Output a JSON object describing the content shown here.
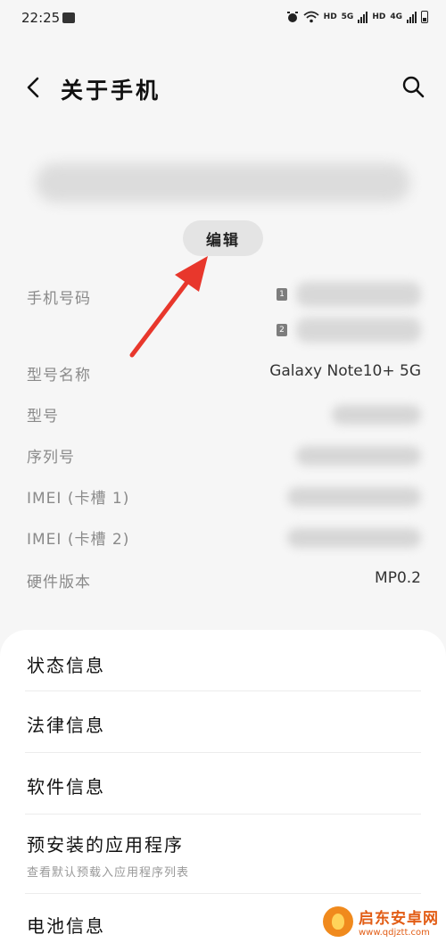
{
  "status_bar": {
    "time": "22:25",
    "indicators": [
      "HD",
      "5G",
      "HD",
      "4G"
    ],
    "icons": [
      "photo-icon",
      "alarm-icon",
      "wifi-icon",
      "signal-icon",
      "battery-icon"
    ]
  },
  "header": {
    "title": "关于手机",
    "back_icon": "back-arrow-icon",
    "search_icon": "search-icon"
  },
  "device": {
    "edit_label": "编辑"
  },
  "info": {
    "phone_number": {
      "label": "手机号码",
      "sim1_badge": "1",
      "sim2_badge": "2"
    },
    "model_name": {
      "label": "型号名称",
      "value": "Galaxy Note10+ 5G"
    },
    "model": {
      "label": "型号"
    },
    "serial": {
      "label": "序列号"
    },
    "imei1": {
      "label": "IMEI (卡槽 1)"
    },
    "imei2": {
      "label": "IMEI (卡槽 2)"
    },
    "hardware": {
      "label": "硬件版本",
      "value": "MP0.2"
    }
  },
  "menu": {
    "items": [
      {
        "label": "状态信息"
      },
      {
        "label": "法律信息"
      },
      {
        "label": "软件信息"
      },
      {
        "label": "预安装的应用程序",
        "sub": "查看默认预载入应用程序列表"
      },
      {
        "label": "电池信息"
      }
    ]
  },
  "annotation": {
    "arrow_color": "#e8372c"
  },
  "watermark": {
    "name": "启东安卓网",
    "url": "www.qdjztt.com"
  }
}
